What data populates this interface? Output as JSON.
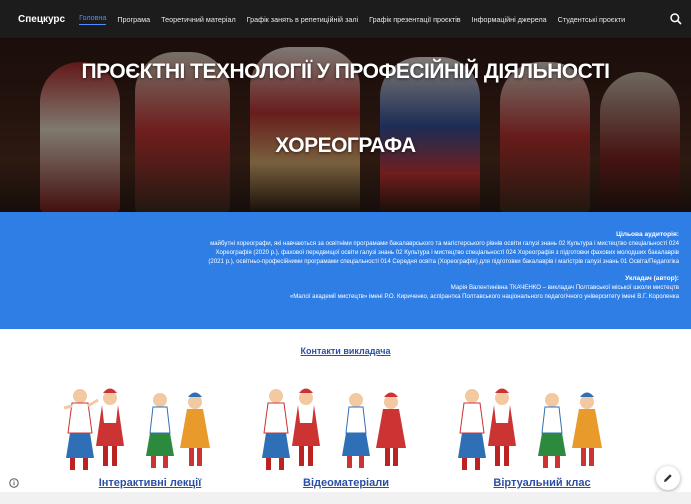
{
  "topbar": {
    "brand": "Спецкурс",
    "nav": [
      {
        "label": "Головна",
        "active": true
      },
      {
        "label": "Програма"
      },
      {
        "label": "Теоретичний матеріал"
      },
      {
        "label": "Графік занять в репетиційній залі"
      },
      {
        "label": "Графік презентації проєктів"
      },
      {
        "label": "Інформаційні джерела"
      },
      {
        "label": "Студентські проєкти"
      }
    ],
    "search_icon": "search-icon"
  },
  "hero": {
    "title_line1": "ПРОЄКТНІ ТЕХНОЛОГІЇ У ПРОФЕСІЙНІЙ ДІЯЛЬНОСТІ",
    "title_line2": "ХОРЕОГРАФА"
  },
  "band": {
    "audience_heading": "Цільова аудиторія:",
    "audience_lines": [
      "майбутні хореографи, які навчаються за освітніми програмами бакалаврського та магістерського рівнів освіти галузі знань 02 Культура і мистецтво спеціальності 024",
      "Хореографія (2020 р.), фахової передвищої освіти галузі знань 02 Культура і мистецтво спеціальності 024 Хореографія з підготовки фахових молодших бакалаврів",
      "(2021 р.), освітньо-професійними програмами спеціальності 014 Середня освіта (Хореографія) для підготовки бакалаврів і магістрів галузі знань 01 Освіта/Педагогіка"
    ],
    "author_heading": "Укладач (автор):",
    "author_lines": [
      "Марія Валентинівна ТКАЧЕНКО – викладач Полтавської міської школи мистецтв",
      "«Малої академії мистецтв» імені Р.О. Кириченко, аспірантка Полтавського національного педагогічного університету імені В.Г. Короленка"
    ]
  },
  "contacts_link": "Контакти викладача",
  "cards": [
    {
      "label": "Інтерактивні лекції"
    },
    {
      "label": "Відеоматеріали"
    },
    {
      "label": "Віртуальний клас"
    }
  ],
  "colors": {
    "band_blue": "#2f7ee6",
    "link_blue": "#2b4fa6",
    "nav_active": "#4d8dff",
    "topbar": "#1c1c1c"
  }
}
